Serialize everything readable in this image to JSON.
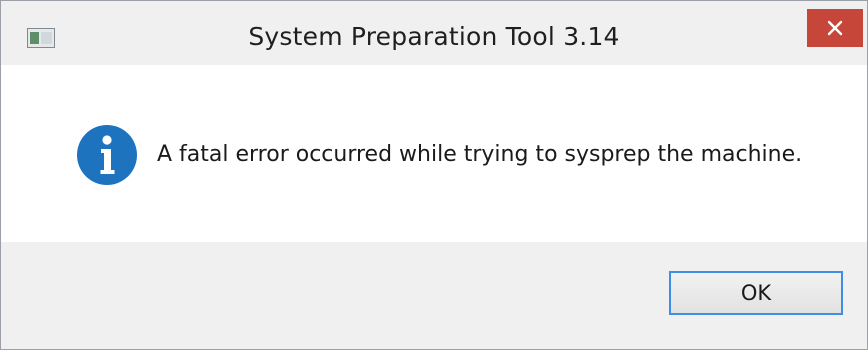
{
  "window": {
    "title": "System Preparation Tool 3.14"
  },
  "dialog": {
    "icon": "info-icon",
    "message": "A fatal error occurred while trying to sysprep the machine."
  },
  "buttons": {
    "ok_label": "OK",
    "close_icon": "close-icon"
  },
  "colors": {
    "close_button": "#c7463a",
    "info_icon": "#1e73be",
    "ok_focus_border": "#3d8ee6"
  }
}
